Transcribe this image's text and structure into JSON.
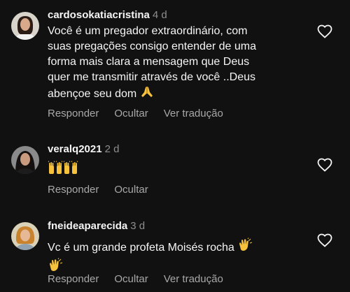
{
  "comments": [
    {
      "username": "cardosokatiacristina",
      "time": "4 d",
      "text_lines": [
        "Você é um pregador extraordinário, com",
        "suas pregações consigo entender de uma",
        "forma mais clara a mensagem que Deus",
        "quer me transmitir através de você ..Deus",
        "abençoe seu dom"
      ],
      "emoji": "praying-hands",
      "actions": {
        "reply": "Responder",
        "hide": "Ocultar",
        "translate": "Ver tradução"
      }
    },
    {
      "username": "veralq2021",
      "time": "2 d",
      "emoji_line": [
        "raising-hands",
        "raising-hands"
      ],
      "actions": {
        "reply": "Responder",
        "hide": "Ocultar"
      }
    },
    {
      "username": "fneideaparecida",
      "time": "3 d",
      "text_lines": [
        "Vc é um grande profeta Moisés rocha"
      ],
      "emoji": "clapping-hands",
      "emoji_line2": "clapping-hands",
      "actions": {
        "reply": "Responder",
        "hide": "Ocultar",
        "translate": "Ver tradução"
      }
    }
  ],
  "colors": {
    "background": "#111111",
    "text": "#f5f5f5",
    "secondary": "#8e8e8e",
    "action": "#a8a8a8"
  }
}
